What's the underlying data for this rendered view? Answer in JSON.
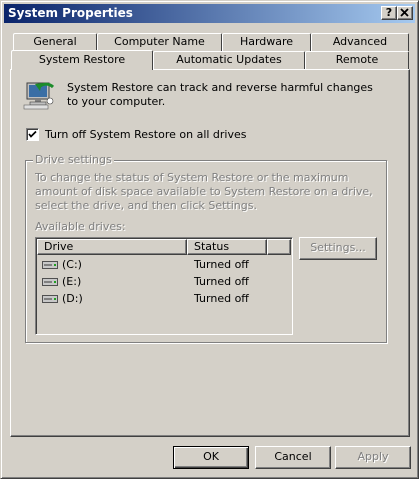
{
  "window": {
    "title": "System Properties",
    "help_button": "?",
    "close_button": "×"
  },
  "tabs": {
    "row_back": [
      {
        "label": "General"
      },
      {
        "label": "Computer Name"
      },
      {
        "label": "Hardware"
      },
      {
        "label": "Advanced"
      }
    ],
    "row_front": [
      {
        "label": "System Restore",
        "active": true
      },
      {
        "label": "Automatic Updates"
      },
      {
        "label": "Remote"
      }
    ]
  },
  "system_restore": {
    "intro": "System Restore can track and reverse harmful changes to your computer.",
    "turn_off_checkbox": {
      "label": "Turn off System Restore on all drives",
      "checked": true
    },
    "drive_settings": {
      "legend": "Drive settings",
      "description": "To change the status of System Restore or the maximum amount of disk space available to System Restore on a drive, select the drive, and then click Settings.",
      "available_label": "Available drives:",
      "columns": [
        "Drive",
        "Status"
      ],
      "drives": [
        {
          "name": "(C:)",
          "status": "Turned off"
        },
        {
          "name": "(E:)",
          "status": "Turned off"
        },
        {
          "name": "(D:)",
          "status": "Turned off"
        }
      ],
      "settings_button": "Settings..."
    }
  },
  "footer": {
    "ok": "OK",
    "cancel": "Cancel",
    "apply": "Apply"
  },
  "colors": {
    "face": "#d4d0c8",
    "title_start": "#0a246a",
    "title_end": "#a6caf0",
    "disabled_text": "#808080"
  },
  "icons": {
    "restore": "system-restore-icon",
    "drive": "hard-drive-icon",
    "check": "checkmark-icon"
  }
}
